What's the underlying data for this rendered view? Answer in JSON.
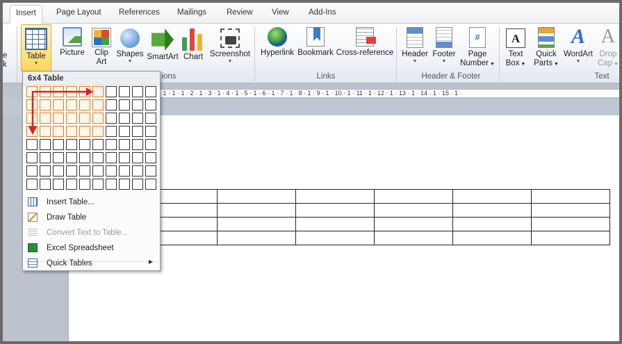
{
  "tabs": [
    {
      "label": "Insert",
      "active": true
    },
    {
      "label": "Page Layout"
    },
    {
      "label": "References"
    },
    {
      "label": "Mailings"
    },
    {
      "label": "Review"
    },
    {
      "label": "View"
    },
    {
      "label": "Add-Ins"
    }
  ],
  "ribbon": {
    "partial_left": {
      "line1": "e",
      "line2": "k"
    },
    "table": {
      "label": "Table",
      "icon": "table-icon"
    },
    "picture": {
      "label": "Picture",
      "icon": "picture-icon"
    },
    "clip_art": {
      "line1": "Clip",
      "line2": "Art",
      "icon": "clip-art-icon"
    },
    "shapes": {
      "label": "Shapes",
      "icon": "shapes-icon"
    },
    "smartart": {
      "label": "SmartArt",
      "icon": "smartart-icon"
    },
    "chart": {
      "label": "Chart",
      "icon": "chart-icon"
    },
    "screenshot": {
      "label": "Screenshot",
      "icon": "screenshot-icon"
    },
    "hyperlink": {
      "label": "Hyperlink",
      "icon": "hyperlink-icon"
    },
    "bookmark": {
      "label": "Bookmark",
      "icon": "bookmark-icon"
    },
    "cross_reference": {
      "label": "Cross-reference",
      "icon": "cross-reference-icon"
    },
    "header": {
      "label": "Header",
      "icon": "header-icon"
    },
    "footer": {
      "label": "Footer",
      "icon": "footer-icon"
    },
    "page_number": {
      "line1": "Page",
      "line2": "Number",
      "icon": "page-number-icon",
      "glyph": "#"
    },
    "text_box": {
      "line1": "Text",
      "line2": "Box",
      "icon": "text-box-icon",
      "glyph": "A"
    },
    "quick_parts": {
      "line1": "Quick",
      "line2": "Parts",
      "icon": "quick-parts-icon"
    },
    "wordart": {
      "label": "WordArt",
      "icon": "wordart-icon",
      "glyph": "A"
    },
    "drop_cap": {
      "line1": "Drop",
      "line2": "Cap",
      "icon": "drop-cap-icon",
      "glyph": "A"
    },
    "groups": {
      "illustrations_partial": "ions",
      "links": "Links",
      "header_footer": "Header & Footer",
      "text": "Text"
    }
  },
  "ruler": {
    "text": "· 1 · 1 · 1 · 2 · 1 · 3 · 1 · 4 · 1 · 5 · 1 · 6 · 1 · 7 · 1 · 8 · 1 · 9 · 1 · 10 · 1 · 11 · 1 · 12 · 1 · 13 · 1 · 14 · 1 · 15 · 1 ·"
  },
  "dropdown": {
    "title": "6x4 Table",
    "grid": {
      "columns": 10,
      "rows": 8,
      "selected_columns": 6,
      "selected_rows": 4
    },
    "annotation_color": "#d8202a",
    "items": [
      {
        "label": "Insert Table...",
        "icon": "insert-table-icon",
        "enabled": true
      },
      {
        "label": "Draw Table",
        "icon": "draw-table-icon",
        "enabled": true
      },
      {
        "label": "Convert Text to Table...",
        "icon": "convert-text-icon",
        "enabled": false
      },
      {
        "label": "Excel Spreadsheet",
        "icon": "excel-spreadsheet-icon",
        "enabled": true
      },
      {
        "label": "Quick Tables",
        "icon": "quick-tables-icon",
        "enabled": true,
        "submenu": true
      }
    ]
  },
  "document": {
    "table": {
      "columns": 6,
      "rows": 4
    }
  },
  "colors": {
    "selection_orange": "#e07b1a",
    "table_button_yellow": "#ffd657",
    "ribbon_blue": "#3b6aa8"
  }
}
